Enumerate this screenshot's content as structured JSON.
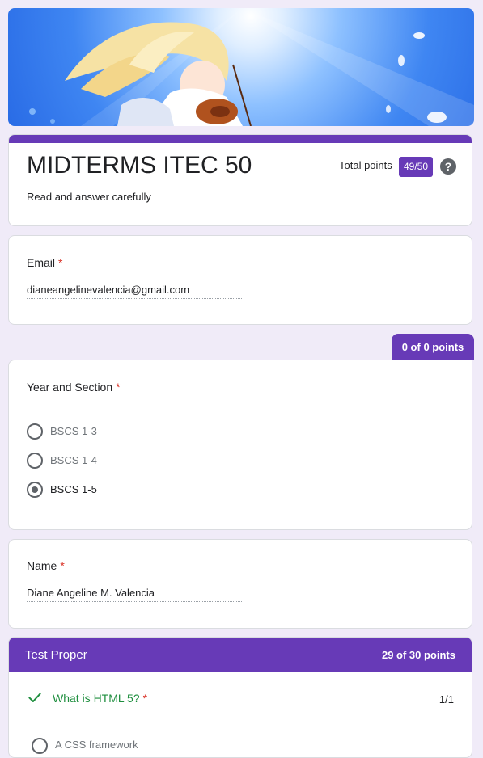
{
  "form": {
    "title": "MIDTERMS ITEC 50",
    "description": "Read and answer carefully",
    "total_points_label": "Total points",
    "total_score": "49/50",
    "help_icon_glyph": "?"
  },
  "email": {
    "label": "Email",
    "required_mark": "*",
    "value": "dianeangelinevalencia@gmail.com"
  },
  "section_points": "0 of 0 points",
  "year_section": {
    "label": "Year and Section",
    "required_mark": "*",
    "options": [
      {
        "label": "BSCS 1-3",
        "selected": false
      },
      {
        "label": "BSCS 1-4",
        "selected": false
      },
      {
        "label": "BSCS 1-5",
        "selected": true
      }
    ]
  },
  "name": {
    "label": "Name",
    "required_mark": "*",
    "value": "Diane Angeline M. Valencia"
  },
  "test_proper": {
    "title": "Test Proper",
    "points": "29 of 30 points",
    "question1": {
      "text": "What is HTML 5?",
      "required_mark": "*",
      "score": "1/1",
      "partial_option": "A CSS framework"
    }
  },
  "colors": {
    "accent": "#673ab7",
    "background": "#f0ebf8",
    "required": "#d93025",
    "correct": "#1e8e3e"
  },
  "icons": {
    "help": "help-icon",
    "correct": "check-icon",
    "banner": "anime-violinist-banner"
  }
}
